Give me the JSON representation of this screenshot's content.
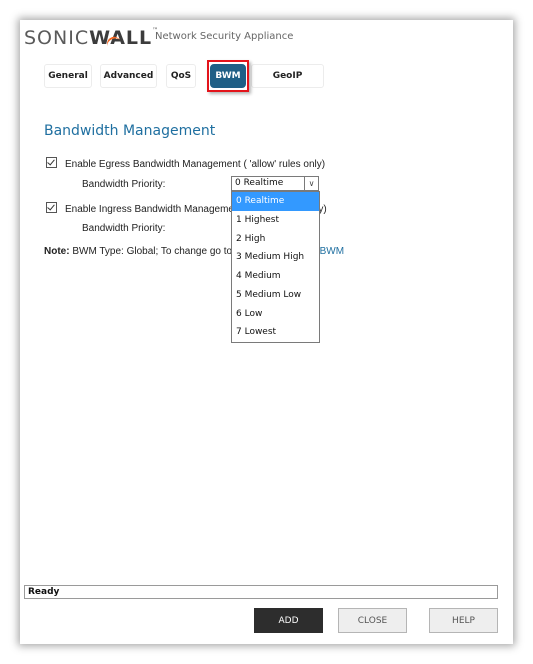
{
  "header": {
    "logo_text_light": "SONIC",
    "logo_text_bold": "WALL",
    "logo_tm": "™",
    "subtitle": "Network Security Appliance"
  },
  "tabs": [
    {
      "label": "General",
      "active": false
    },
    {
      "label": "Advanced",
      "active": false
    },
    {
      "label": "QoS",
      "active": false
    },
    {
      "label": "BWM",
      "active": true
    },
    {
      "label": "GeoIP",
      "active": false
    }
  ],
  "section": {
    "title": "Bandwidth Management"
  },
  "egress": {
    "checkbox_label": "Enable Egress Bandwidth Management ( 'allow' rules only)",
    "checked": true,
    "priority_label": "Bandwidth Priority:",
    "priority_value": "0 Realtime"
  },
  "ingress": {
    "checkbox_label": "Enable Ingress Bandwidth Management ( 'allow' rules only)",
    "checked": true,
    "priority_label": "Bandwidth Priority:"
  },
  "note": {
    "prefix": "Note:",
    "text": " BWM Type: Global; To change go to ",
    "link": "Firewall Settings > BWM"
  },
  "dropdown": {
    "options": [
      "0 Realtime",
      "1 Highest",
      "2 High",
      "3 Medium High",
      "4 Medium",
      "5 Medium Low",
      "6 Low",
      "7 Lowest"
    ],
    "selected_index": 0
  },
  "status": {
    "text": "Ready"
  },
  "buttons": {
    "add": "ADD",
    "close": "CLOSE",
    "help": "HELP"
  },
  "icons": {
    "select_arrow": "chevron-down-icon",
    "checkbox": "checkbox-checked-icon"
  },
  "colors": {
    "accent_tab": "#1f5f86",
    "highlight_border": "#e3141b",
    "section_title": "#1f6fa0",
    "dropdown_selected": "#3399ff",
    "primary_button": "#2d2d2d"
  }
}
